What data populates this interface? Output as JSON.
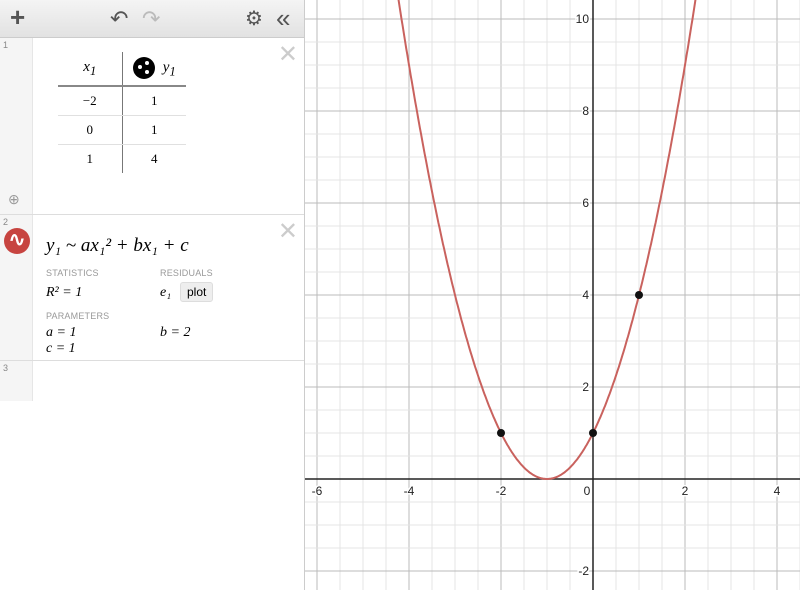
{
  "toolbar": {
    "add": "+",
    "undo": "↶",
    "redo": "↷",
    "settings": "⚙",
    "collapse": "«"
  },
  "expressions": [
    {
      "number": "1",
      "type": "table",
      "columns": [
        "x",
        "y"
      ],
      "subscript": "1",
      "rows": [
        [
          "−2",
          "1"
        ],
        [
          "0",
          "1"
        ],
        [
          "1",
          "4"
        ]
      ],
      "icon": "point-style-icon"
    },
    {
      "number": "2",
      "formula": "y₁ ~ ax₁² + bx₁ + c",
      "statistics_label": "STATISTICS",
      "r2": "R² = 1",
      "residuals_label": "RESIDUALS",
      "residual_var": "e₁",
      "plot_button": "plot",
      "parameters_label": "PARAMETERS",
      "params": [
        "a = 1",
        "b = 2",
        "c = 1"
      ]
    },
    {
      "number": "3"
    }
  ],
  "colors": {
    "curve": "#c9625e",
    "points": "#111111",
    "logo": "#c74440"
  },
  "chart_data": {
    "type": "scatter",
    "xlim": [
      -6.26,
      4.5
    ],
    "ylim": [
      -2.4,
      10.4
    ],
    "x_ticks": [
      -6,
      -4,
      -2,
      0,
      2,
      4
    ],
    "y_ticks": [
      -2,
      2,
      4,
      6,
      8,
      10
    ],
    "grid": true,
    "points": [
      [
        -2,
        1
      ],
      [
        0,
        1
      ],
      [
        1,
        4
      ]
    ],
    "curve": {
      "a": 1,
      "b": 2,
      "c": 1
    }
  }
}
